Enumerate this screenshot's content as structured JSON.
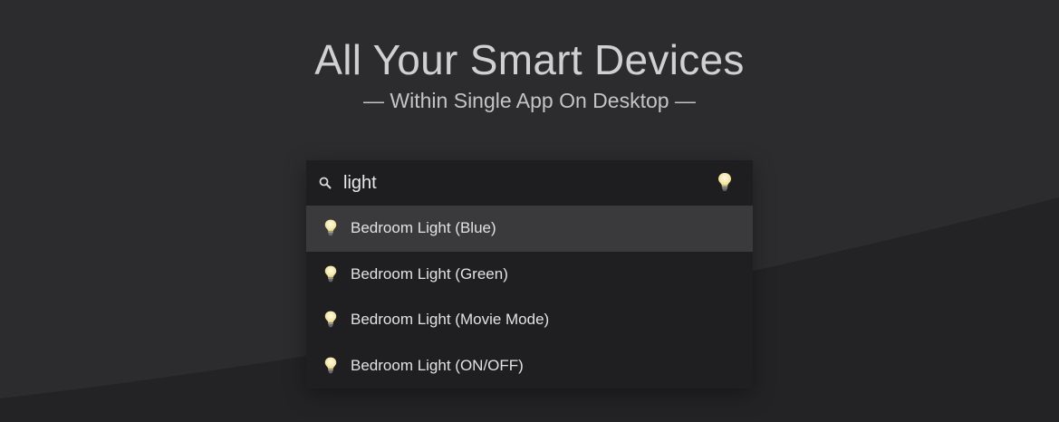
{
  "hero": {
    "title": "All Your Smart Devices",
    "subtitle": "— Within Single App On Desktop —"
  },
  "launcher": {
    "search": {
      "icon": "search-icon",
      "value": "light",
      "trailing_icon": "light-bulb-icon"
    },
    "results": [
      {
        "label": "Bedroom Light (Blue)",
        "icon": "light-bulb-icon",
        "selected": true
      },
      {
        "label": "Bedroom Light (Green)",
        "icon": "light-bulb-icon",
        "selected": false
      },
      {
        "label": "Bedroom Light (Movie Mode)",
        "icon": "light-bulb-icon",
        "selected": false
      },
      {
        "label": "Bedroom Light (ON/OFF)",
        "icon": "light-bulb-icon",
        "selected": false
      }
    ]
  },
  "colors": {
    "background": "#2c2c2e",
    "background_lower": "#222224",
    "panel": "#1f1f21",
    "selected_row": "#3a3a3c",
    "text": "#e2e2e4"
  }
}
